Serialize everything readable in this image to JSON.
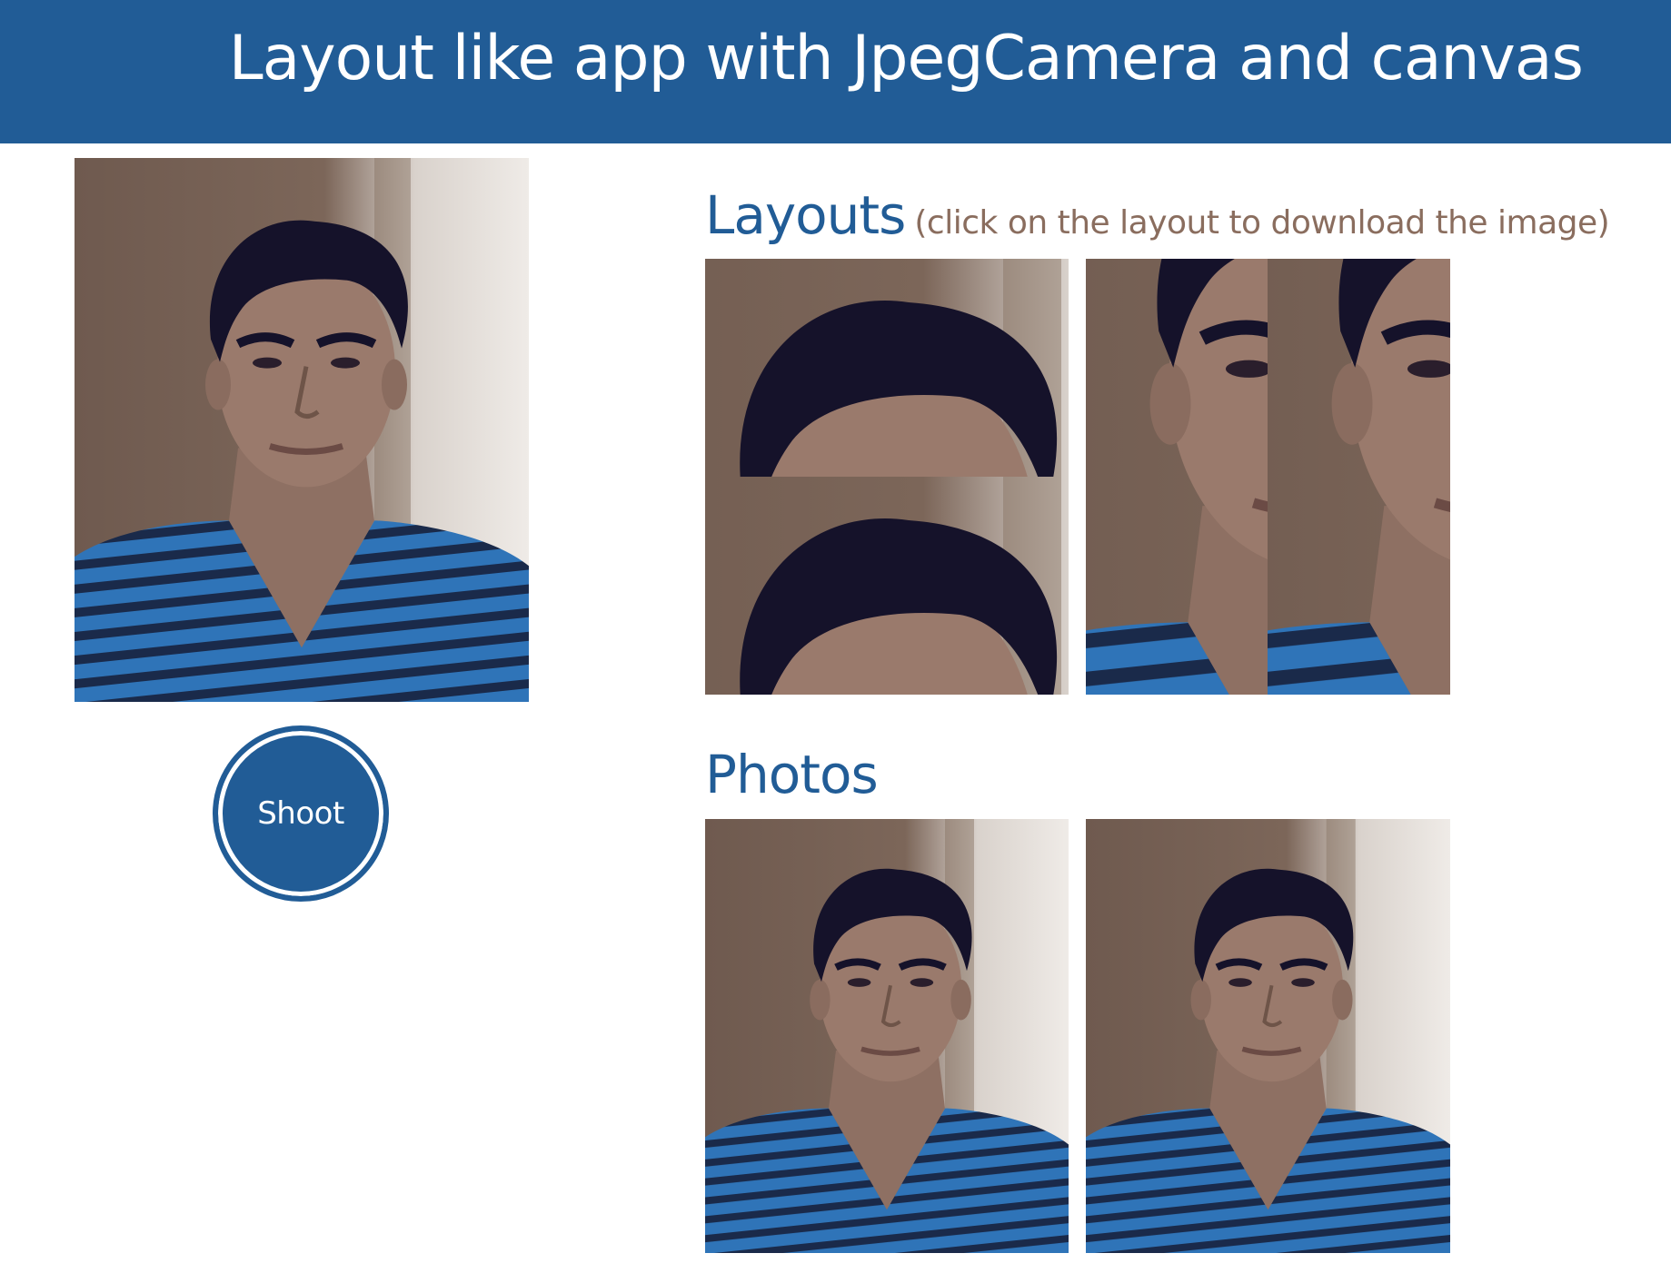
{
  "header": {
    "title": "Layout like app with JpegCamera and canvas"
  },
  "camera": {
    "shoot_label": "Shoot"
  },
  "layouts": {
    "title": "Layouts",
    "hint": "(click on the layout to download the image)",
    "items": [
      {
        "name": "layout-two-stacked"
      },
      {
        "name": "layout-two-side-by-side"
      }
    ]
  },
  "photos": {
    "title": "Photos",
    "count": 2
  },
  "colors": {
    "brand": "#215c96",
    "hint_text": "#8a6d5e",
    "background": "#ffffff"
  }
}
